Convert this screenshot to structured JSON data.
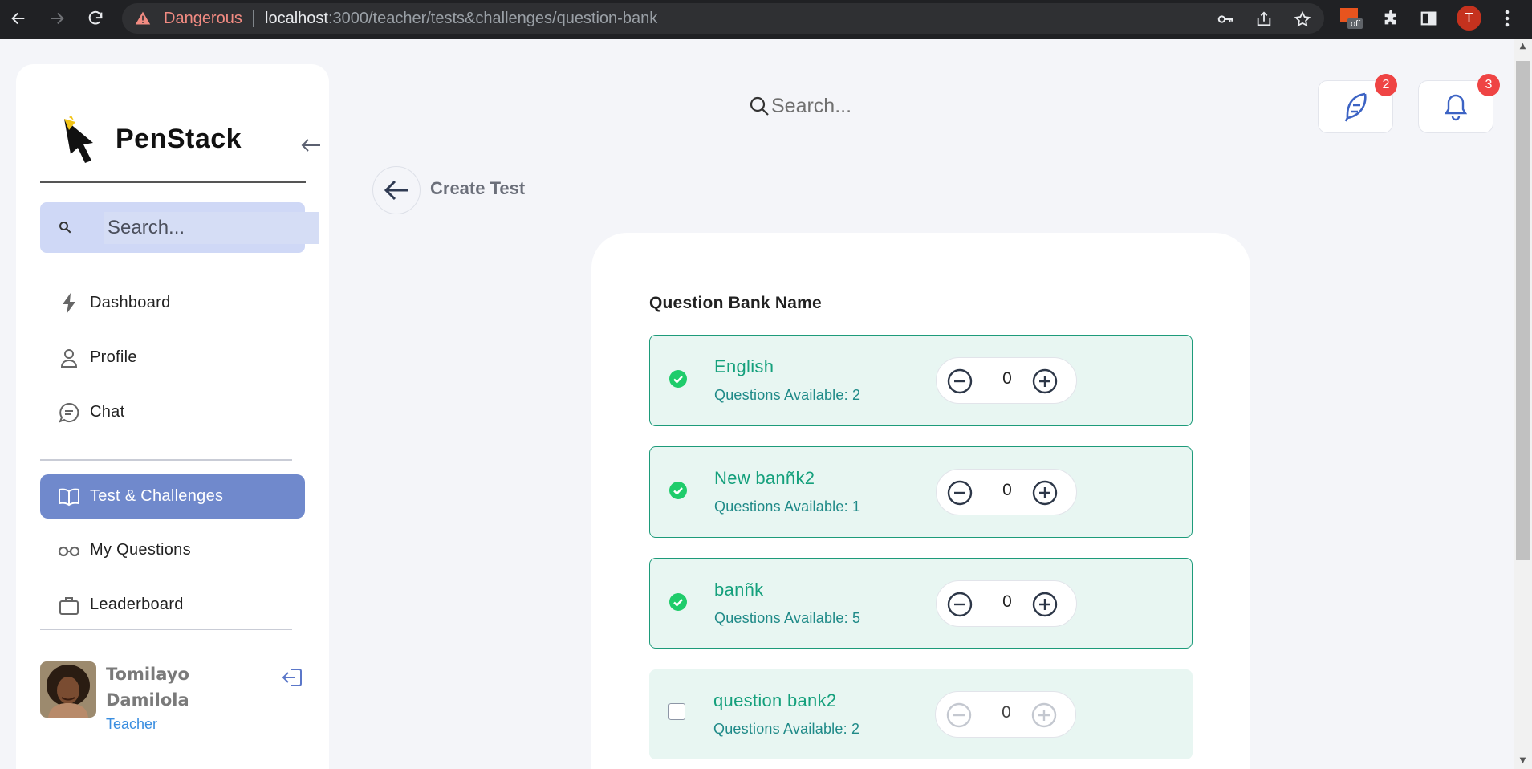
{
  "browser": {
    "security_label": "Dangerous",
    "url_host": "localhost",
    "url_path": ":3000/teacher/tests&challenges/question-bank",
    "extension_badge": "off",
    "profile_initial": "T"
  },
  "sidebar": {
    "logo_text": "PenStack",
    "search_placeholder": "Search...",
    "items": [
      {
        "label": "Dashboard",
        "icon": "bolt-icon",
        "active": false
      },
      {
        "label": "Profile",
        "icon": "user-icon",
        "active": false
      },
      {
        "label": "Chat",
        "icon": "chat-icon",
        "active": false
      },
      {
        "label": "Test & Challenges",
        "icon": "book-icon",
        "active": true
      },
      {
        "label": "My Questions",
        "icon": "glasses-icon",
        "active": false
      },
      {
        "label": "Leaderboard",
        "icon": "briefcase-icon",
        "active": false
      }
    ],
    "user": {
      "name": "Tomilayo Damilola",
      "role": "Teacher"
    }
  },
  "header": {
    "search_placeholder": "Search...",
    "feather_badge": "2",
    "bell_badge": "3"
  },
  "page": {
    "title": "Create Test",
    "section_label": "Question Bank Name"
  },
  "question_banks": [
    {
      "name": "English",
      "available": "Questions Available: 2",
      "count": "0",
      "selected": true
    },
    {
      "name": "New banñk2",
      "available": "Questions Available: 1",
      "count": "0",
      "selected": true
    },
    {
      "name": "banñk",
      "available": "Questions Available: 5",
      "count": "0",
      "selected": true
    },
    {
      "name": "question bank2",
      "available": "Questions Available: 2",
      "count": "0",
      "selected": false
    }
  ],
  "colors": {
    "accent": "#7089cc",
    "selected_text": "#14a07c",
    "badge": "#ef4444"
  }
}
